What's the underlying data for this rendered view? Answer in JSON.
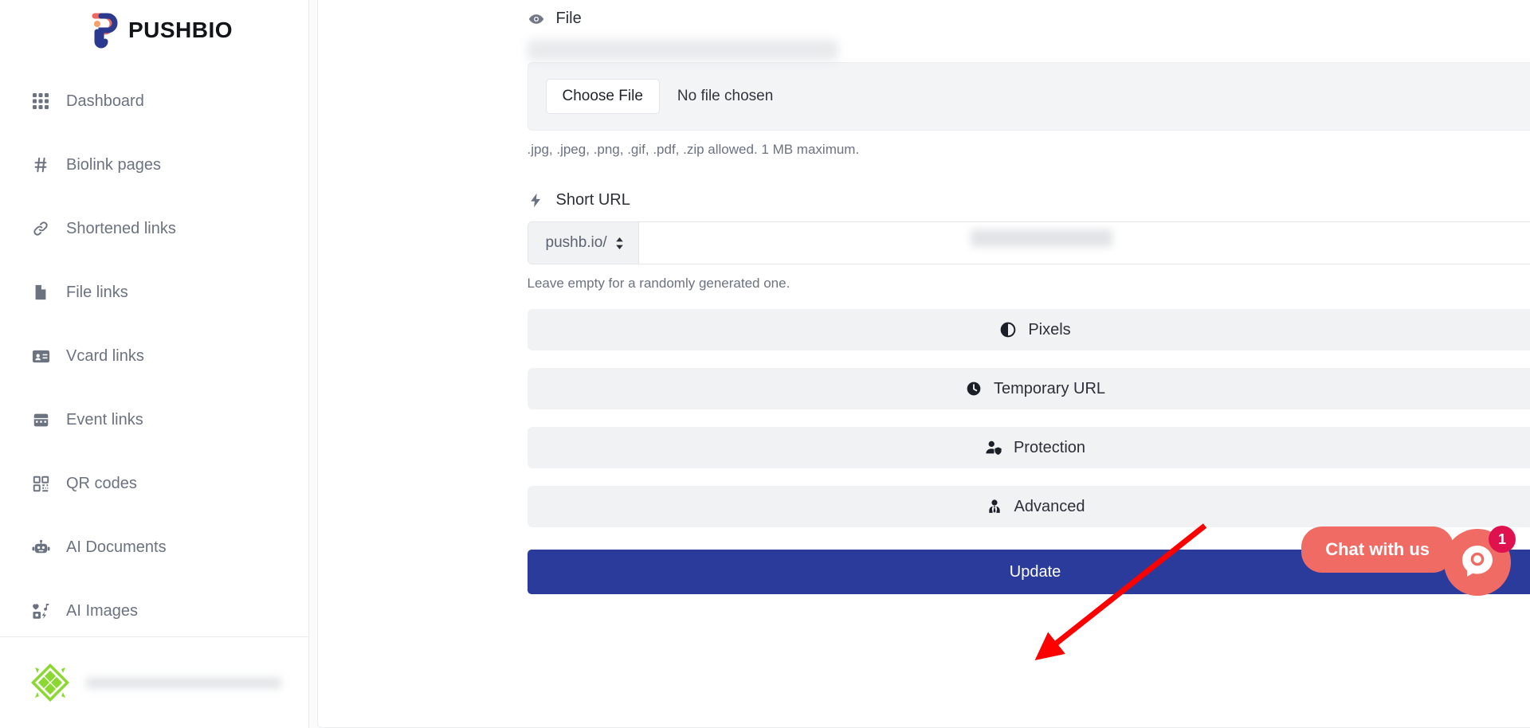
{
  "brand": {
    "name": "PUSHBIO",
    "logo_icon": "pushbio-logo-icon"
  },
  "sidebar": {
    "items": [
      {
        "label": "Dashboard",
        "icon": "grid-icon"
      },
      {
        "label": "Biolink pages",
        "icon": "hash-icon"
      },
      {
        "label": "Shortened links",
        "icon": "link-icon"
      },
      {
        "label": "File links",
        "icon": "file-icon"
      },
      {
        "label": "Vcard links",
        "icon": "id-card-icon"
      },
      {
        "label": "Event links",
        "icon": "calendar-icon"
      },
      {
        "label": "QR codes",
        "icon": "qr-code-icon"
      },
      {
        "label": "AI Documents",
        "icon": "robot-icon"
      },
      {
        "label": "AI Images",
        "icon": "ai-image-icon"
      }
    ],
    "footer": {
      "avatar_icon": "user-avatar-icon",
      "name": "",
      "email": ""
    }
  },
  "form": {
    "file_section": {
      "label": "File",
      "label_icon": "eye-icon",
      "choose_file_label": "Choose File",
      "file_status": "No file chosen",
      "hint": ".jpg, .jpeg, .png, .gif, .pdf, .zip allowed. 1 MB maximum."
    },
    "short_url_section": {
      "label": "Short URL",
      "label_icon": "lightning-icon",
      "domain_selected": "pushb.io/",
      "slug_value": "",
      "slug_placeholder": "",
      "hint": "Leave empty for a randomly generated one."
    },
    "sections": [
      {
        "label": "Pixels",
        "icon": "contrast-circle-icon"
      },
      {
        "label": "Temporary URL",
        "icon": "clock-icon"
      },
      {
        "label": "Protection",
        "icon": "user-shield-icon"
      },
      {
        "label": "Advanced",
        "icon": "user-tie-icon"
      }
    ],
    "submit_label": "Update"
  },
  "chat": {
    "bubble_label": "Chat with us",
    "badge_count": "1",
    "launcher_icon": "chat-launcher-icon",
    "accent_color": "#ef6b63",
    "badge_color": "#e0114f"
  },
  "annotation": {
    "arrow_color": "#ff0000"
  },
  "colors": {
    "primary_button": "#2a3b9b",
    "section_button_bg": "#f1f2f4",
    "sidebar_text": "#6b7280"
  }
}
